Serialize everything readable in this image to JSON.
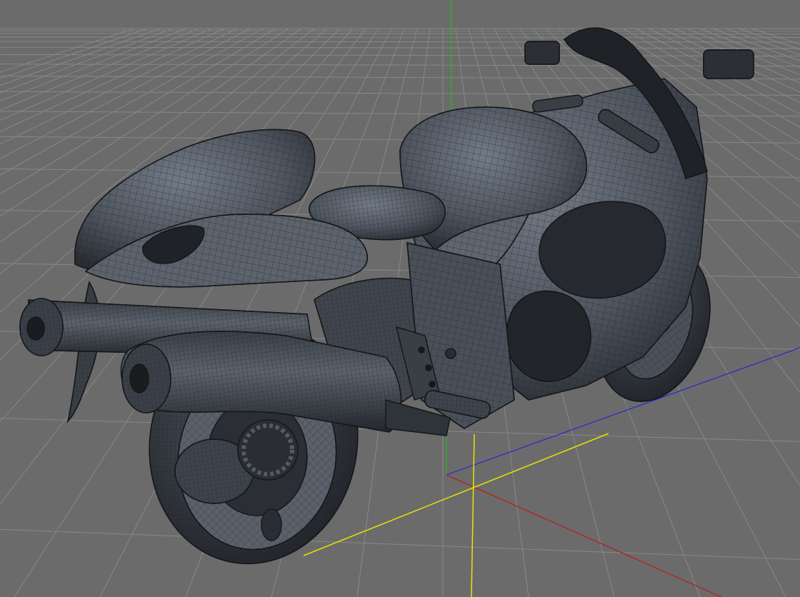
{
  "viewport": {
    "title": "",
    "colors": {
      "background": "#6b6b6b",
      "grid": "#8a8a8a",
      "axis_x": "#c01818",
      "axis_y": "#22b822",
      "axis_z": "#2828d0",
      "pivot_gizmo": "#e6e600",
      "mesh_fill_dark": "#333840",
      "mesh_fill_light": "#59606a",
      "wire": "#1c1f24"
    },
    "model": {
      "name": "",
      "icon": "motorcycle-mesh-icon",
      "display_mode": "shaded-wireframe"
    },
    "axes": [
      "x-axis",
      "y-axis",
      "z-axis"
    ]
  }
}
